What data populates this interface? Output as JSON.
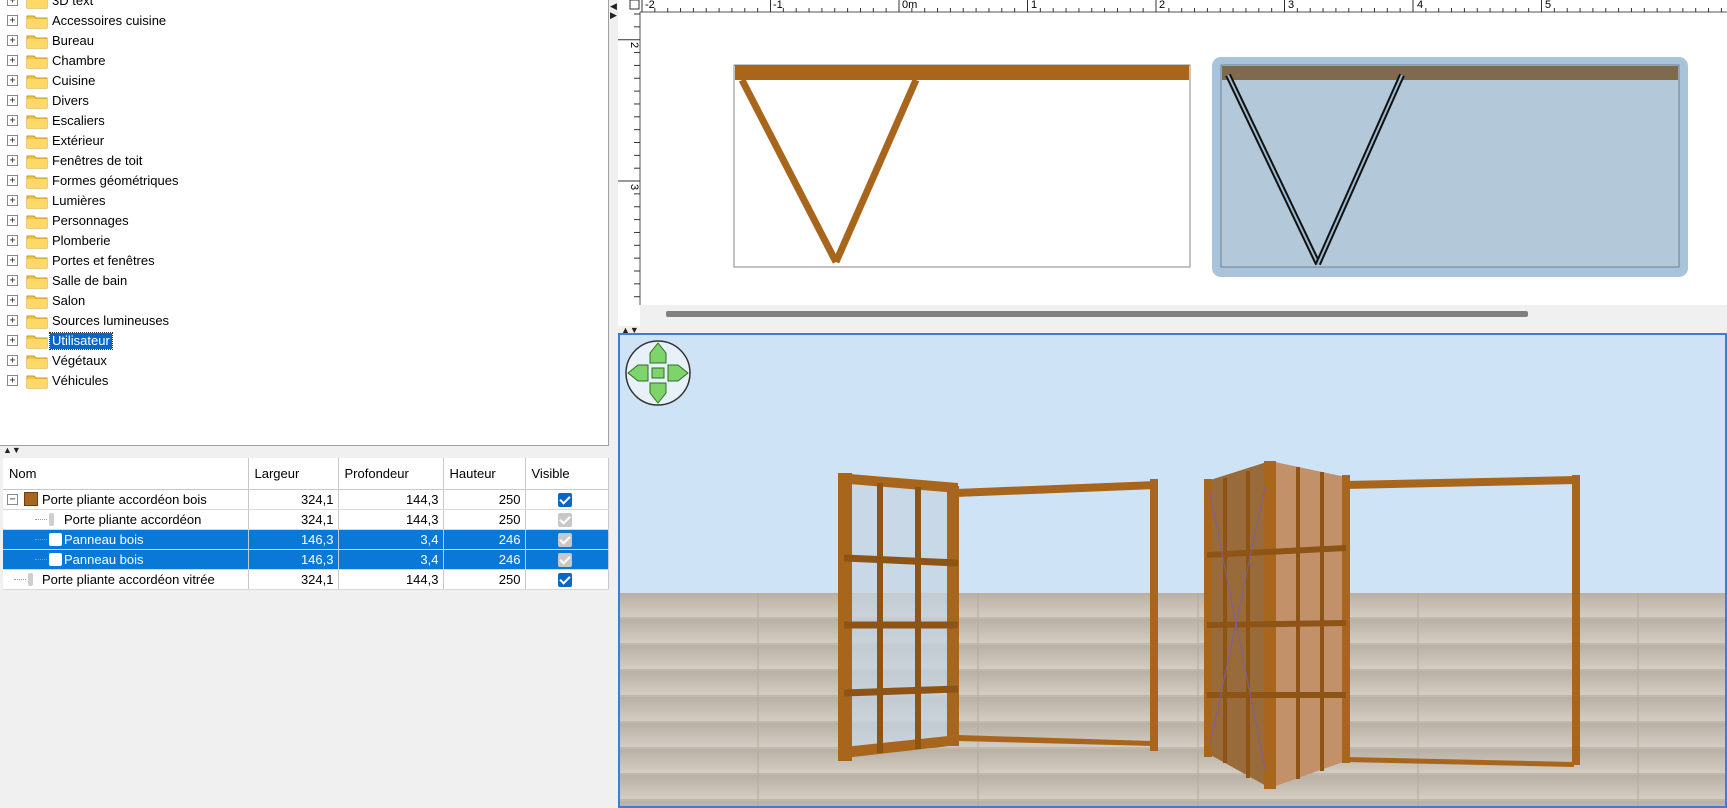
{
  "catalog": {
    "categories": [
      {
        "label": "3D text"
      },
      {
        "label": "Accessoires cuisine"
      },
      {
        "label": "Bureau"
      },
      {
        "label": "Chambre"
      },
      {
        "label": "Cuisine"
      },
      {
        "label": "Divers"
      },
      {
        "label": "Escaliers"
      },
      {
        "label": "Extérieur"
      },
      {
        "label": "Fenêtres de toit"
      },
      {
        "label": "Formes géométriques"
      },
      {
        "label": "Lumières"
      },
      {
        "label": "Personnages"
      },
      {
        "label": "Plomberie"
      },
      {
        "label": "Portes et fenêtres"
      },
      {
        "label": "Salle de bain"
      },
      {
        "label": "Salon"
      },
      {
        "label": "Sources lumineuses"
      },
      {
        "label": "Utilisateur",
        "selected": true
      },
      {
        "label": "Végétaux"
      },
      {
        "label": "Véhicules"
      }
    ],
    "expand_glyph": "+",
    "icons": {
      "expand": "plus-box-icon",
      "folder": "folder-icon"
    }
  },
  "furniture": {
    "columns": [
      "Nom",
      "Largeur",
      "Profondeur",
      "Hauteur",
      "Visible"
    ],
    "rows": [
      {
        "name": "Porte pliante accordéon bois",
        "width": "324,1",
        "depth": "144,3",
        "height": "250",
        "visible": "checked",
        "level": 0,
        "group": true,
        "selected": false
      },
      {
        "name": "Porte pliante accordéon",
        "width": "324,1",
        "depth": "144,3",
        "height": "250",
        "visible": "disabled",
        "level": 1,
        "group": false,
        "selected": false
      },
      {
        "name": "Panneau bois",
        "width": "146,3",
        "depth": "3,4",
        "height": "246",
        "visible": "disabled",
        "level": 1,
        "group": false,
        "selected": true
      },
      {
        "name": "Panneau bois",
        "width": "146,3",
        "depth": "3,4",
        "height": "246",
        "visible": "disabled",
        "level": 1,
        "group": false,
        "selected": true
      },
      {
        "name": "Porte pliante accordéon vitrée",
        "width": "324,1",
        "depth": "144,3",
        "height": "250",
        "visible": "checked",
        "level": 0,
        "group": false,
        "selected": false
      }
    ],
    "collapse_glyph": "−"
  },
  "plan": {
    "ruler_top": [
      "-2",
      "-1",
      "0m",
      "1",
      "2",
      "3",
      "4",
      "5"
    ],
    "ruler_left": [
      "2",
      "3"
    ]
  },
  "colors": {
    "selection": "#0a78d7",
    "wood": "#a8661c",
    "sky": "#cfe3f7",
    "floor": "#c9c0b4",
    "plan_selection": "#a9c3da"
  }
}
